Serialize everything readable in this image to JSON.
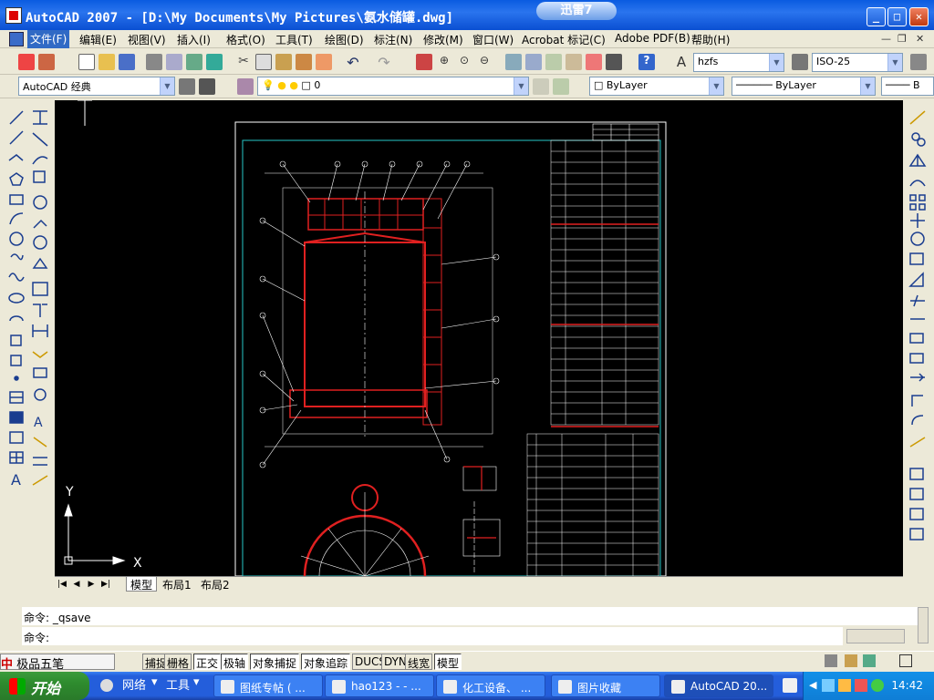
{
  "window": {
    "title": "AutoCAD 2007 - [D:\\My Documents\\My Pictures\\氨水储罐.dwg]",
    "xunlei_label": "迅雷7"
  },
  "menu": {
    "items": [
      "文件(F)",
      "编辑(E)",
      "视图(V)",
      "插入(I)",
      "格式(O)",
      "工具(T)",
      "绘图(D)",
      "标注(N)",
      "修改(M)",
      "窗口(W)",
      "Acrobat 标记(C)",
      "Adobe PDF(B)",
      "帮助(H)"
    ]
  },
  "toolbar": {
    "text_style": "hzfs",
    "dim_style": "ISO-25"
  },
  "layers_bar": {
    "workspace": "AutoCAD 经典",
    "layer": "0",
    "color": "ByLayer",
    "linetype": "ByLayer",
    "lineweight": "B"
  },
  "canvas": {
    "ucs_y": "Y",
    "ucs_x": "X"
  },
  "layout_tabs": [
    "模型",
    "布局1",
    "布局2"
  ],
  "command": {
    "history": "命令:  _qsave",
    "prompt": "命令:"
  },
  "status": {
    "ime": "极品五笔",
    "toggles": [
      "捕捉",
      "栅格",
      "正交",
      "极轴",
      "对象捕捉",
      "对象追踪",
      "DUCS",
      "DYN",
      "线宽",
      "模型"
    ]
  },
  "taskbar": {
    "start": "开始",
    "quick": [
      "网络",
      "工具"
    ],
    "tasks": [
      "图纸专帖 ( ...",
      "hao123 - - ...",
      "化工设备、 ...",
      "图片收藏",
      "AutoCAD 20..."
    ],
    "clock": "14:42"
  },
  "colors": {
    "title_blue": "#0a5be0",
    "canvas_bg": "#000000",
    "drawing_red": "#e02020",
    "taskbar": "#245edb",
    "start_green": "#3c9c3c"
  }
}
